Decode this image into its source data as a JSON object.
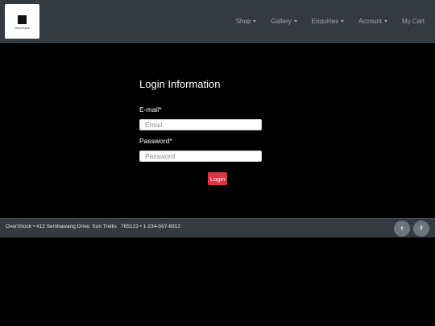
{
  "brand": {
    "name": "OverShock"
  },
  "nav": {
    "items": [
      {
        "label": "Shop",
        "dropdown": true
      },
      {
        "label": "Gallery",
        "dropdown": true
      },
      {
        "label": "Enquiries",
        "dropdown": true
      },
      {
        "label": "Account",
        "dropdown": true
      },
      {
        "label": "My Cart",
        "dropdown": false
      }
    ]
  },
  "login": {
    "title": "Login Information",
    "email_label": "E-mail*",
    "email_placeholder": "Email",
    "email_value": "",
    "password_label": "Password*",
    "password_placeholder": "Password",
    "password_value": "",
    "submit_label": "Login"
  },
  "footer": {
    "text": "OverShock • 412 Sembawang Drive, Sun Trellis   765123 • 1-234-567-8912",
    "social": [
      {
        "name": "twitter-icon",
        "glyph": "t"
      },
      {
        "name": "facebook-icon",
        "glyph": "f"
      }
    ]
  },
  "colors": {
    "navbar_bg": "#343a40",
    "page_bg": "#000000",
    "button_danger": "#dc3545",
    "social_bg": "#6c757d"
  }
}
